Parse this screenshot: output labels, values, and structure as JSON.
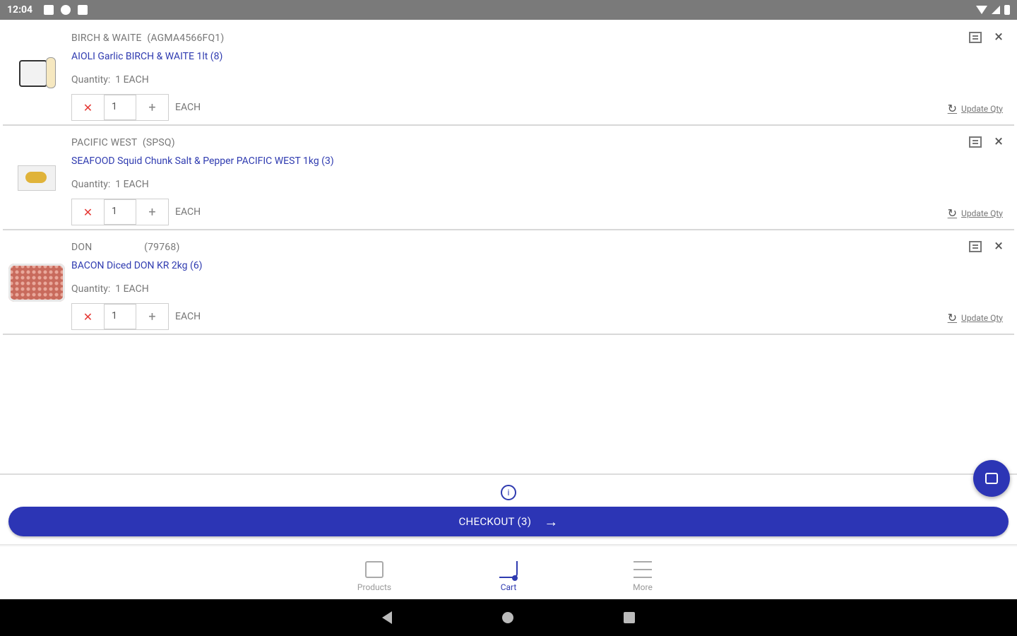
{
  "status_bar": {
    "time": "12:04"
  },
  "cart": {
    "items": [
      {
        "brand": "BIRCH & WAITE",
        "code": "(AGMA4566FQ1)",
        "name": "AIOLI Garlic BIRCH & WAITE 1lt (8)",
        "quantity_label": "Quantity:",
        "quantity_text": "1 EACH",
        "qty_value": "1",
        "unit": "EACH",
        "update_label": "Update Qty",
        "thumbnail": "aioli-product"
      },
      {
        "brand": "PACIFIC WEST",
        "code": "(SPSQ)",
        "name": "SEAFOOD Squid Chunk Salt & Pepper PACIFIC WEST 1kg (3)",
        "quantity_label": "Quantity:",
        "quantity_text": "1 EACH",
        "qty_value": "1",
        "unit": "EACH",
        "update_label": "Update Qty",
        "thumbnail": "squid-product"
      },
      {
        "brand": "DON",
        "code": "(79768)",
        "name": "BACON Diced DON KR 2kg (6)",
        "quantity_label": "Quantity:",
        "quantity_text": "1 EACH",
        "qty_value": "1",
        "unit": "EACH",
        "update_label": "Update Qty",
        "thumbnail": "bacon-product"
      }
    ],
    "checkout_label": "CHECKOUT (3)",
    "info_icon": "info-circle-icon",
    "fab_icon": "edit-note-icon"
  },
  "tabs": [
    {
      "label": "Products",
      "icon": "box-icon"
    },
    {
      "label": "Cart",
      "icon": "cart-icon"
    },
    {
      "label": "More",
      "icon": "menu-icon"
    }
  ],
  "colors": {
    "accent": "#2c35b5",
    "link": "#2f3bb0",
    "delete": "#e53935",
    "status_bar": "#7a7a7a"
  }
}
